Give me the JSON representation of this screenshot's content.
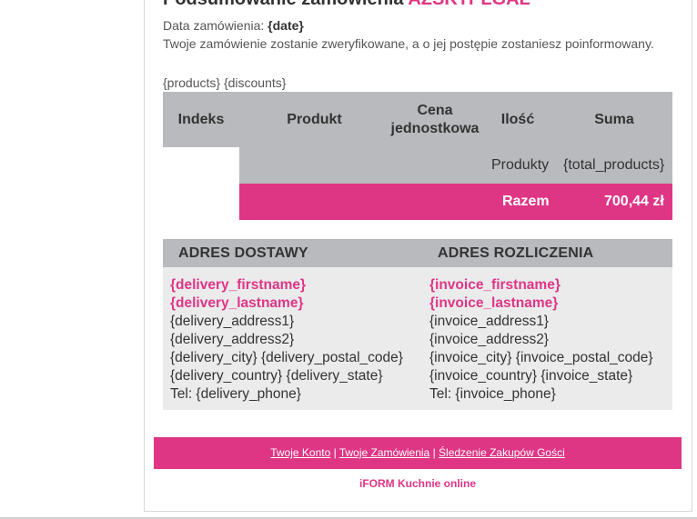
{
  "header": {
    "title_prefix": "Podsumowanie zamówienia",
    "title_accent": "AZSKTPLGAL",
    "date_label": "Data zamówienia:",
    "date_value": "{date}",
    "status_text": "Twoje zamówienie zostanie zweryfikowane, a o jej postępie zostaniesz poinformowany."
  },
  "placeholders_text": "{products} {discounts}",
  "order_table": {
    "columns": [
      "Indeks",
      "Produkt",
      "Cena jednostkowa",
      "Ilość",
      "Suma"
    ],
    "products_row": {
      "label": "Produkty",
      "value": "{total_products}"
    },
    "total_row": {
      "label": "Razem",
      "value": "700,44 zł"
    }
  },
  "addresses": {
    "delivery": {
      "heading": "ADRES DOSTAWY",
      "firstname": "{delivery_firstname}",
      "lastname": "{delivery_lastname}",
      "address1": "{delivery_address1}",
      "address2": "{delivery_address2}",
      "city_postal": "{delivery_city} {delivery_postal_code}",
      "country_state": "{delivery_country} {delivery_state}",
      "phone": "Tel: {delivery_phone}"
    },
    "invoice": {
      "heading": "ADRES ROZLICZENIA",
      "firstname": "{invoice_firstname}",
      "lastname": "{invoice_lastname}",
      "address1": "{invoice_address1}",
      "address2": "{invoice_address2}",
      "city_postal": "{invoice_city} {invoice_postal_code}",
      "country_state": "{invoice_country} {invoice_state}",
      "phone": "Tel: {invoice_phone}"
    }
  },
  "footer": {
    "links": [
      "Twoje Konto",
      "Twoje Zamówienia",
      "Śledzenie Zakupów Gości"
    ],
    "separator": "|",
    "shop_name": "iFORM Kuchnie online"
  },
  "colors": {
    "accent": "#df3585",
    "header_gray": "#b9babd",
    "panel_gray": "#ebebec"
  }
}
